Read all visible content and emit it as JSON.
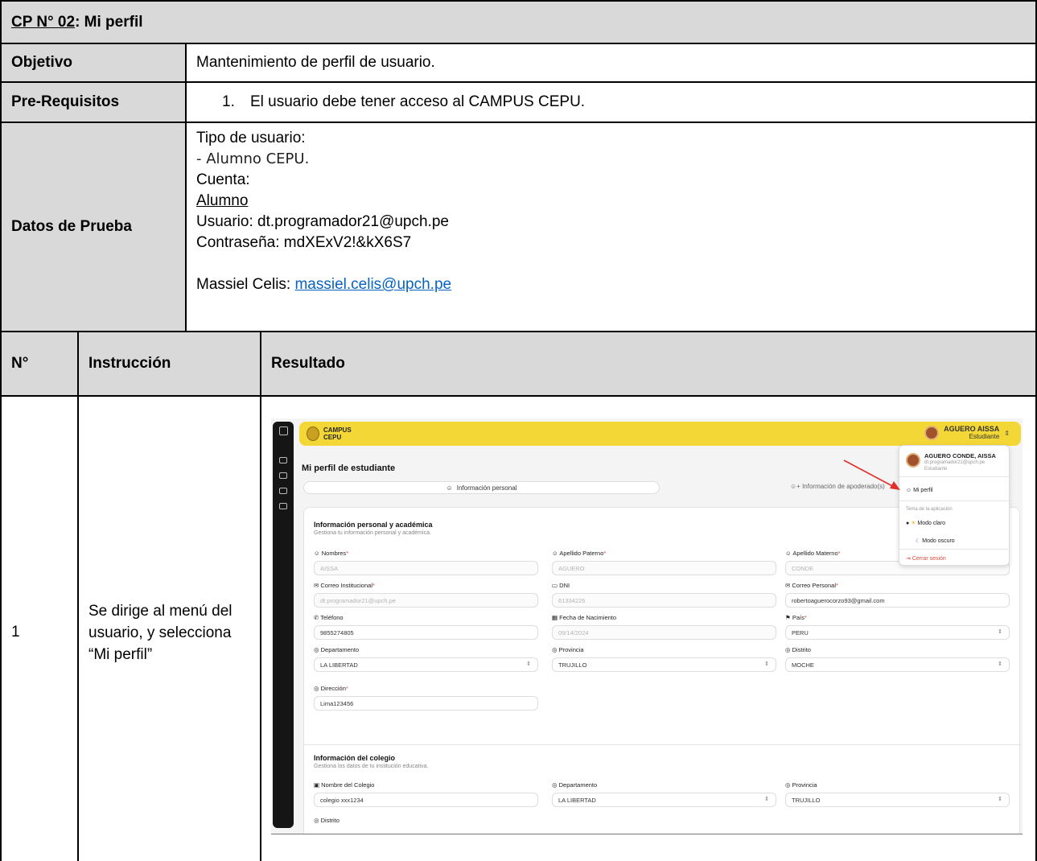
{
  "doc": {
    "title_code": "CP N° 02",
    "title_rest": ": Mi perfil",
    "objetivo_label": "Objetivo",
    "objetivo_value": "Mantenimiento de perfil de usuario.",
    "prereq_label": "Pre-Requisitos",
    "prereq_num": "1.",
    "prereq_value": "El usuario debe tener acceso al CAMPUS CEPU.",
    "datos_label": "Datos de Prueba",
    "datos_tipo": "Tipo de usuario:",
    "datos_alumno_cepu": "- Alumno CEPU.",
    "datos_cuenta": "Cuenta:",
    "datos_alumno": "Alumno",
    "datos_usuario": "Usuario: dt.programador21@upch.pe",
    "datos_pass": "Contraseña: mdXExV2!&kX6S7",
    "datos_contact_label": "Massiel Celis: ",
    "datos_contact_email": "massiel.celis@upch.pe",
    "col_num": "N°",
    "col_instr": "Instrucción",
    "col_result": "Resultado",
    "row1_num": "1",
    "row1_instr": "Se dirige al menú del usuario, y selecciona “Mi perfil”"
  },
  "app": {
    "brand_line1": "CAMPUS",
    "brand_line2": "CEPU",
    "user_name": "AGUERO AISSA",
    "user_role": "Estudiante",
    "page_title": "Mi perfil de estudiante",
    "tab_personal": "Información personal",
    "tab_apoderado": "Información de apoderado(s)",
    "section1_title": "Información personal y académica",
    "section1_sub": "Gestiona tu información personal y académica.",
    "fields": {
      "nombres_label": "Nombres",
      "nombres_value": "AISSA",
      "paterno_label": "Apellido Paterno",
      "paterno_value": "AGUERO",
      "materno_label": "Apellido Materno",
      "materno_value": "CONDE",
      "correo_inst_label": "Correo Institucional",
      "correo_inst_value": "dt.programador21@upch.pe",
      "dni_label": "DNI",
      "dni_value": "61334226",
      "correo_pers_label": "Correo Personal",
      "correo_pers_value": "robertoaguerocorzo93@gmail.com",
      "telefono_label": "Teléfono",
      "telefono_value": "9855274805",
      "nacimiento_label": "Fecha de Nacimiento",
      "nacimiento_value": "09/14/2024",
      "pais_label": "País",
      "pais_value": "PERU",
      "depto_label": "Departamento",
      "depto_value": "LA LIBERTAD",
      "provincia_label": "Provincia",
      "provincia_value": "TRUJILLO",
      "distrito_label": "Distrito",
      "distrito_value": "MOCHE",
      "direccion_label": "Dirección",
      "direccion_value": "Lima123456"
    },
    "section2_title": "Información del colegio",
    "section2_sub": "Gestiona los datos de tu institución educativa.",
    "school": {
      "nombre_label": "Nombre del Colegio",
      "nombre_value": "colegio xxx1234",
      "depto_label": "Departamento",
      "depto_value": "LA LIBERTAD",
      "provincia_label": "Provincia",
      "provincia_value": "TRUJILLO",
      "distrito_label": "Distrito"
    },
    "menu": {
      "full_name": "AGUERO CONDE, AISSA",
      "email": "dt.programador21@upch.pe",
      "role": "Estudiante",
      "mi_perfil": "Mi perfil",
      "theme_title": "Tema de la aplicación",
      "modo_claro": "Modo claro",
      "modo_oscuro": "Modo oscuro",
      "cerrar": "Cerrar sesión"
    },
    "accent_color": "#f3d737",
    "arrow_color": "#e0302a"
  }
}
